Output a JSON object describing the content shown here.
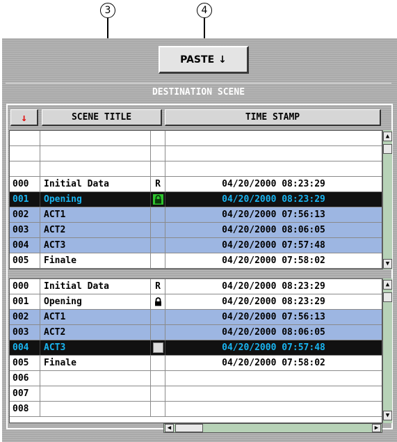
{
  "callouts": {
    "c3": "3",
    "c4": "4"
  },
  "paste_button": {
    "label": "PASTE",
    "icon": "down-arrow-icon"
  },
  "section_title": "DESTINATION SCENE",
  "headers": {
    "sort": "↓",
    "title": "SCENE TITLE",
    "time": "TIME STAMP"
  },
  "list_top": {
    "rows": [
      {
        "num": "",
        "title": "",
        "flag": "",
        "time": ""
      },
      {
        "num": "",
        "title": "",
        "flag": "",
        "time": ""
      },
      {
        "num": "",
        "title": "",
        "flag": "",
        "time": ""
      },
      {
        "num": "000",
        "title": "Initial Data",
        "flag": "R",
        "time": "04/20/2000 08:23:29"
      },
      {
        "num": "001",
        "title": "Opening",
        "flag": "",
        "time": "04/20/2000 08:23:29"
      },
      {
        "num": "002",
        "title": "ACT1",
        "flag": "",
        "time": "04/20/2000 07:56:13"
      },
      {
        "num": "003",
        "title": "ACT2",
        "flag": "",
        "time": "04/20/2000 08:06:05"
      },
      {
        "num": "004",
        "title": "ACT3",
        "flag": "",
        "time": "04/20/2000 07:57:48"
      },
      {
        "num": "005",
        "title": "Finale",
        "flag": "",
        "time": "04/20/2000 07:58:02"
      }
    ]
  },
  "list_bottom": {
    "rows": [
      {
        "num": "000",
        "title": "Initial Data",
        "flag": "R",
        "time": "04/20/2000 08:23:29"
      },
      {
        "num": "001",
        "title": "Opening",
        "flag": "",
        "time": "04/20/2000 08:23:29"
      },
      {
        "num": "002",
        "title": "ACT1",
        "flag": "",
        "time": "04/20/2000 07:56:13"
      },
      {
        "num": "003",
        "title": "ACT2",
        "flag": "",
        "time": "04/20/2000 08:06:05"
      },
      {
        "num": "004",
        "title": "ACT3",
        "flag": "",
        "time": "04/20/2000 07:57:48"
      },
      {
        "num": "005",
        "title": "Finale",
        "flag": "",
        "time": "04/20/2000 07:58:02"
      },
      {
        "num": "006",
        "title": "",
        "flag": "",
        "time": ""
      },
      {
        "num": "007",
        "title": "",
        "flag": "",
        "time": ""
      },
      {
        "num": "008",
        "title": "",
        "flag": "",
        "time": ""
      }
    ]
  },
  "colors": {
    "selected_text": "#19b4f0",
    "highlight_row": "#9db6e2",
    "sort_arrow": "#e01010"
  }
}
